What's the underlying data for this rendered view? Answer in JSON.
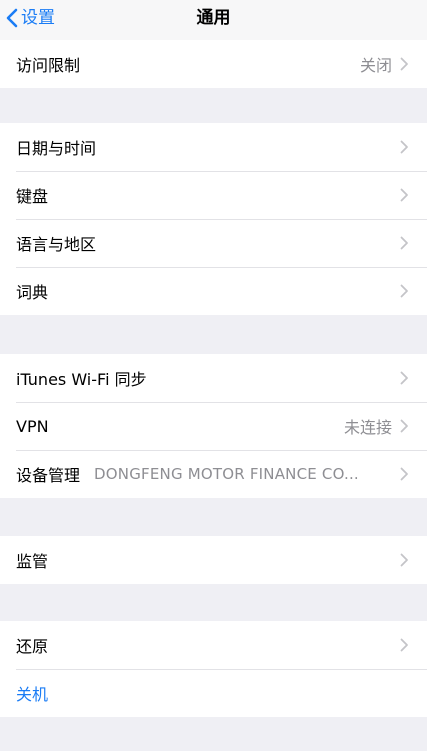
{
  "nav": {
    "back_label": "设置",
    "title": "通用"
  },
  "groups": [
    {
      "rows": [
        {
          "label": "访问限制",
          "value": "关闭"
        }
      ]
    },
    {
      "rows": [
        {
          "label": "日期与时间"
        },
        {
          "label": "键盘"
        },
        {
          "label": "语言与地区"
        },
        {
          "label": "词典"
        }
      ]
    },
    {
      "rows": [
        {
          "label": "iTunes Wi-Fi 同步"
        },
        {
          "label": "VPN",
          "value": "未连接"
        },
        {
          "label": "设备管理",
          "value": "DONGFENG MOTOR FINANCE CO..."
        }
      ]
    },
    {
      "rows": [
        {
          "label": "监管"
        }
      ]
    },
    {
      "rows": [
        {
          "label": "还原"
        },
        {
          "label": "关机"
        }
      ]
    }
  ],
  "icons": {
    "back": "chevron-left-icon",
    "disclosure": "chevron-right-icon"
  },
  "colors": {
    "accent": "#1a7cf5",
    "background": "#efeff4",
    "secondary_text": "#8e8e93"
  }
}
